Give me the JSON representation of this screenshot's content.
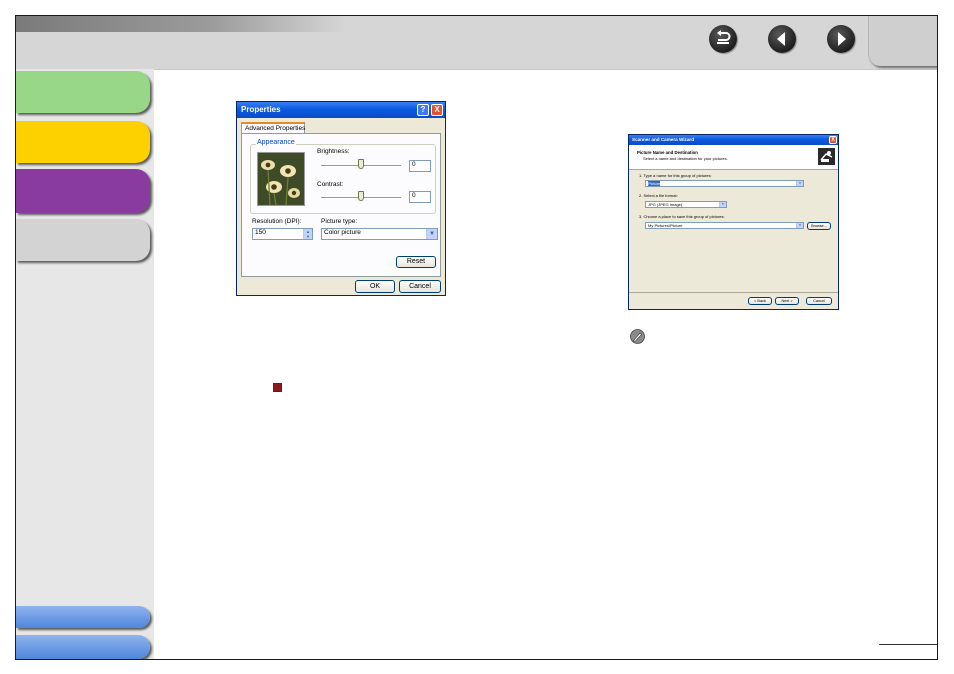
{
  "header": {
    "nav": {
      "back_icon": "return-arrow-icon",
      "prev_icon": "left-arrow-icon",
      "next_icon": "right-arrow-icon"
    }
  },
  "sidebar": {
    "tabs": [
      {
        "color": "#97d787"
      },
      {
        "color": "#fdd000"
      },
      {
        "color": "#8a3ba0"
      },
      {
        "color": "#d3d3d3"
      }
    ],
    "bottom_tabs": [
      {
        "color": "#5b8fdc"
      },
      {
        "color": "#5b8fdc"
      }
    ]
  },
  "properties_dialog": {
    "title": "Properties",
    "help_label": "?",
    "close_label": "X",
    "tab_label": "Advanced Properties",
    "group_label": "Appearance",
    "brightness_label": "Brightness:",
    "brightness_value": "0",
    "contrast_label": "Contrast:",
    "contrast_value": "0",
    "resolution_label": "Resolution (DPI):",
    "resolution_value": "150",
    "picture_type_label": "Picture type:",
    "picture_type_value": "Color picture",
    "reset_label": "Reset",
    "ok_label": "OK",
    "cancel_label": "Cancel"
  },
  "scanner_wizard": {
    "title": "Scanner and Camera Wizard",
    "close_label": "X",
    "heading": "Picture Name and Destination",
    "subheading": "Select a name and destination for your pictures.",
    "step1_label": "1.  Type a name for this group of pictures:",
    "step1_value": "Picture",
    "step2_label": "2.  Select a file format:",
    "step2_value": "JPG (JPEG Image)",
    "step3_label": "3.  Choose a place to save this group of pictures:",
    "step3_value": "My Pictures\\Picture",
    "browse_label": "Browse...",
    "back_label": "< Back",
    "next_label": "Next >",
    "cancel_label": "Cancel"
  },
  "note_icon": "pencil-note-icon",
  "marker_color": "#8b1a1a"
}
